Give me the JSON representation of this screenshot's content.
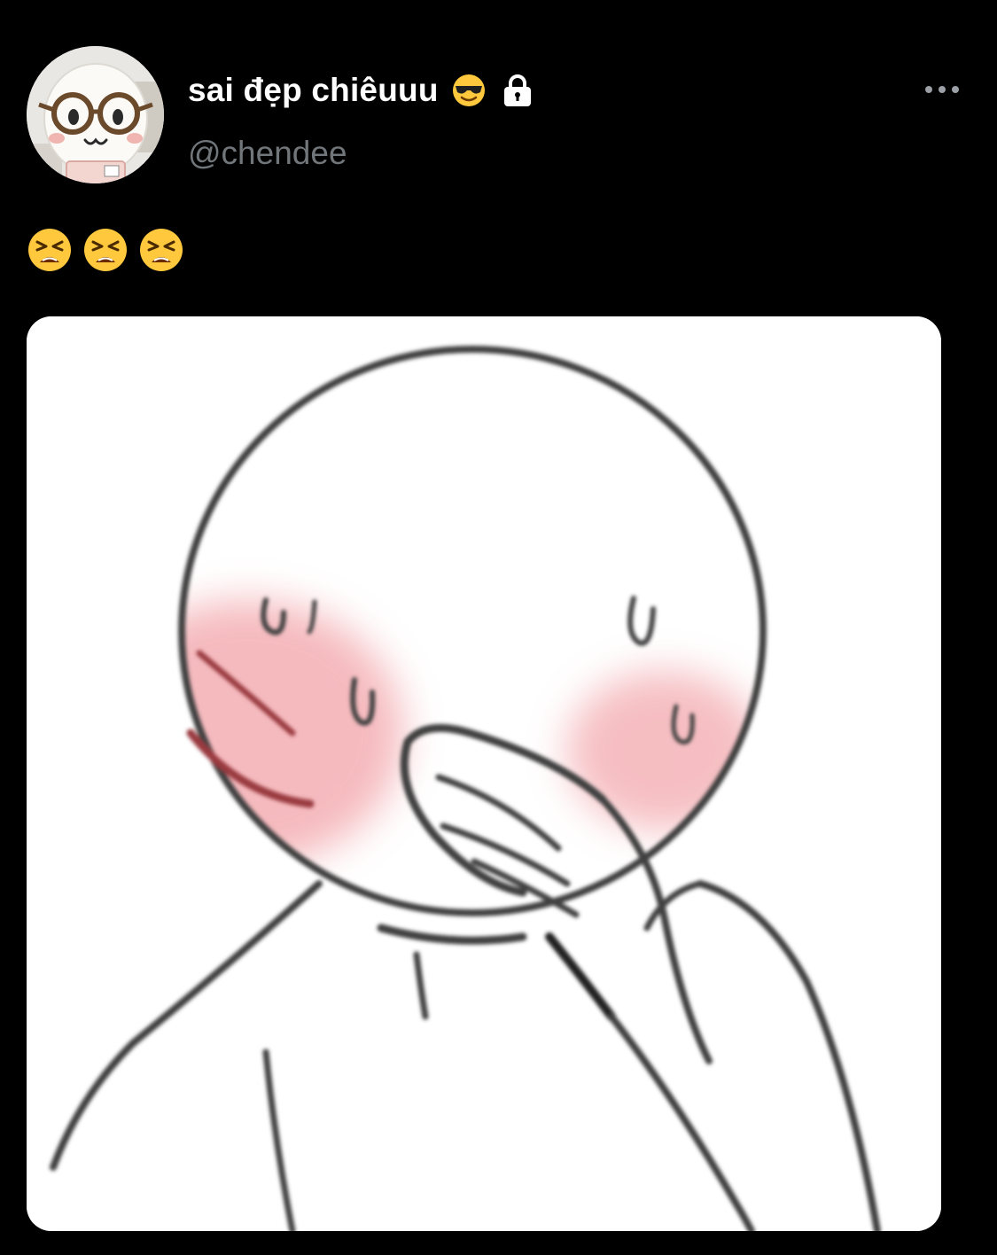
{
  "author": {
    "display_name": "sai đẹp chiêuuu",
    "name_emoji": "😎",
    "name_emoji_icon": "sunglasses-face-icon",
    "protected_icon": "lock-icon",
    "handle": "@chendee",
    "avatar_icon": "plush-toy-with-glasses-avatar"
  },
  "post": {
    "text": "😫😫😫",
    "text_emoji_icon": "tired-face-icon",
    "text_emoji_count": 3,
    "media_icon": "blushing-cartoon-covering-mouth-image"
  },
  "menu": {
    "more_icon": "more-options-icon"
  },
  "colors": {
    "background": "#000000",
    "display_name": "#ffffff",
    "handle": "#71767b",
    "emoji_yellow": "#ffc83d",
    "blush": "#f2a3a8"
  }
}
